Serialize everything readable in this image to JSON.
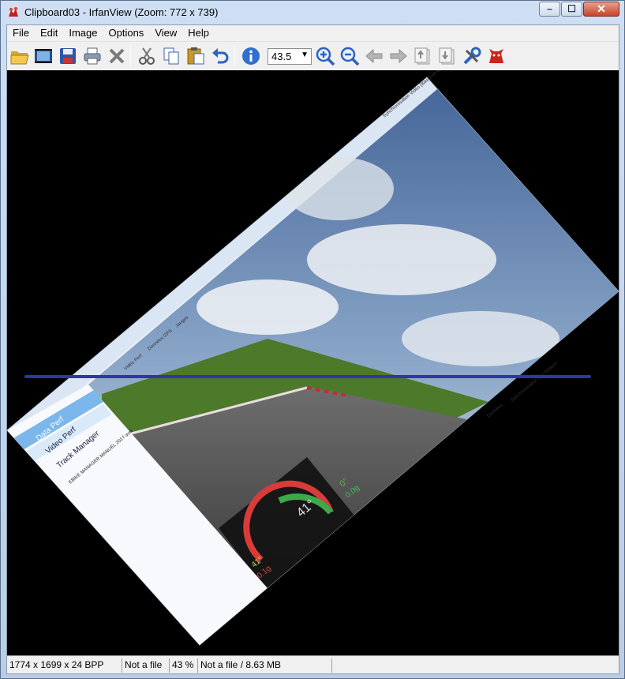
{
  "window": {
    "title": "Clipboard03 - IrfanView (Zoom: 772 x 739)",
    "caption_minimize": "–",
    "caption_maximize": "☐",
    "caption_close": "✕"
  },
  "menu": [
    "File",
    "Edit",
    "Image",
    "Options",
    "View",
    "Help"
  ],
  "toolbar": {
    "zoom_value": "43.5",
    "icons": [
      "open-folder-icon",
      "slideshow-icon",
      "save-icon",
      "print-icon",
      "delete-icon",
      "cut-icon",
      "copy-icon",
      "paste-icon",
      "undo-icon",
      "info-icon",
      "zoom-in-icon",
      "zoom-out-icon",
      "prev-arrow-icon",
      "next-arrow-icon",
      "first-page-icon",
      "last-page-icon",
      "tools-icon",
      "irfanview-cat-icon"
    ]
  },
  "statusbar": {
    "dimensions": "1774 x 1699 x 24 BPP",
    "file_state": "Not a file",
    "zoom_percent": "43 %",
    "size_info": "Not a file / 8.63 MB"
  },
  "embedded": {
    "app_title": "Synchronisation Vidéo [Biker] v4.40",
    "sidebar_items": [
      "Data Perf",
      "Video Perf",
      "Track Manager"
    ],
    "gauge_angle": "41°",
    "gauge_left": "41°",
    "gauge_right": "0°",
    "gauge_g1": "0.0g",
    "gauge_g2": "0.1g",
    "tree_root": "EBIKE MANAGER MANUEL 2017 avril",
    "toolbar_tabs": [
      "Vidéo Perf",
      "Données GPS",
      "Jauges"
    ],
    "panel_tab": "Données",
    "panel_tab2": "Synchronisation des fichiers"
  },
  "colors": {
    "sky_top": "#46679a",
    "sky_bottom": "#cfd8e3",
    "grass": "#4c7a2a",
    "road": "#5a5a5a",
    "blue_line": "#2f36a6"
  }
}
